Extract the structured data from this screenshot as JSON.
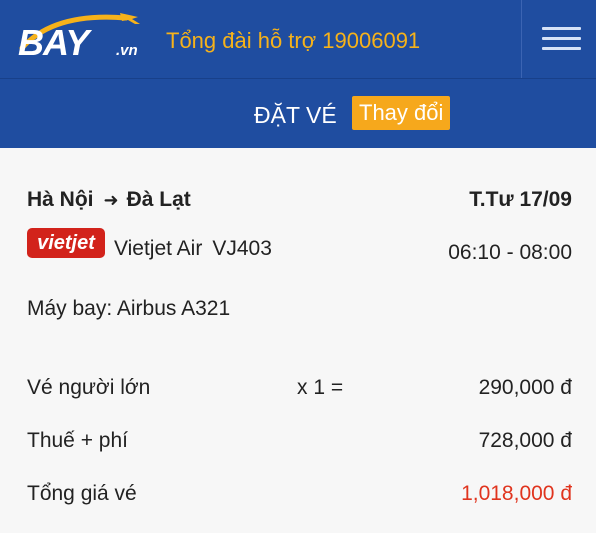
{
  "header": {
    "logo_text": "BAY",
    "logo_suffix": ".vn",
    "hotline": "Tổng đài hỗ trợ 19006091",
    "menu_icon": "hamburger-menu-icon"
  },
  "subheader": {
    "title": "ĐẶT VÉ",
    "change_label": "Thay đổi"
  },
  "flight": {
    "origin": "Hà Nội",
    "destination": "Đà Lạt",
    "date": "T.Tư  17/09",
    "airline_logo_text": "vietjet",
    "airline": "Vietjet Air",
    "flight_no": "VJ403",
    "time": "06:10 - 08:00",
    "aircraft": "Máy bay: Airbus A321"
  },
  "pricing": {
    "adult_label": "Vé người lớn",
    "adult_qty": "x 1 =",
    "adult_amount": "290,000 đ",
    "tax_label": "Thuế + phí",
    "tax_amount": "728,000 đ",
    "total_label": "Tổng giá vé",
    "total_amount": "1,018,000 đ"
  },
  "colors": {
    "header_bg": "#1f4da0",
    "accent_orange": "#f6a81c",
    "hotline_text": "#f6b21a",
    "total_red": "#e0341e",
    "airline_red": "#d2231b"
  }
}
